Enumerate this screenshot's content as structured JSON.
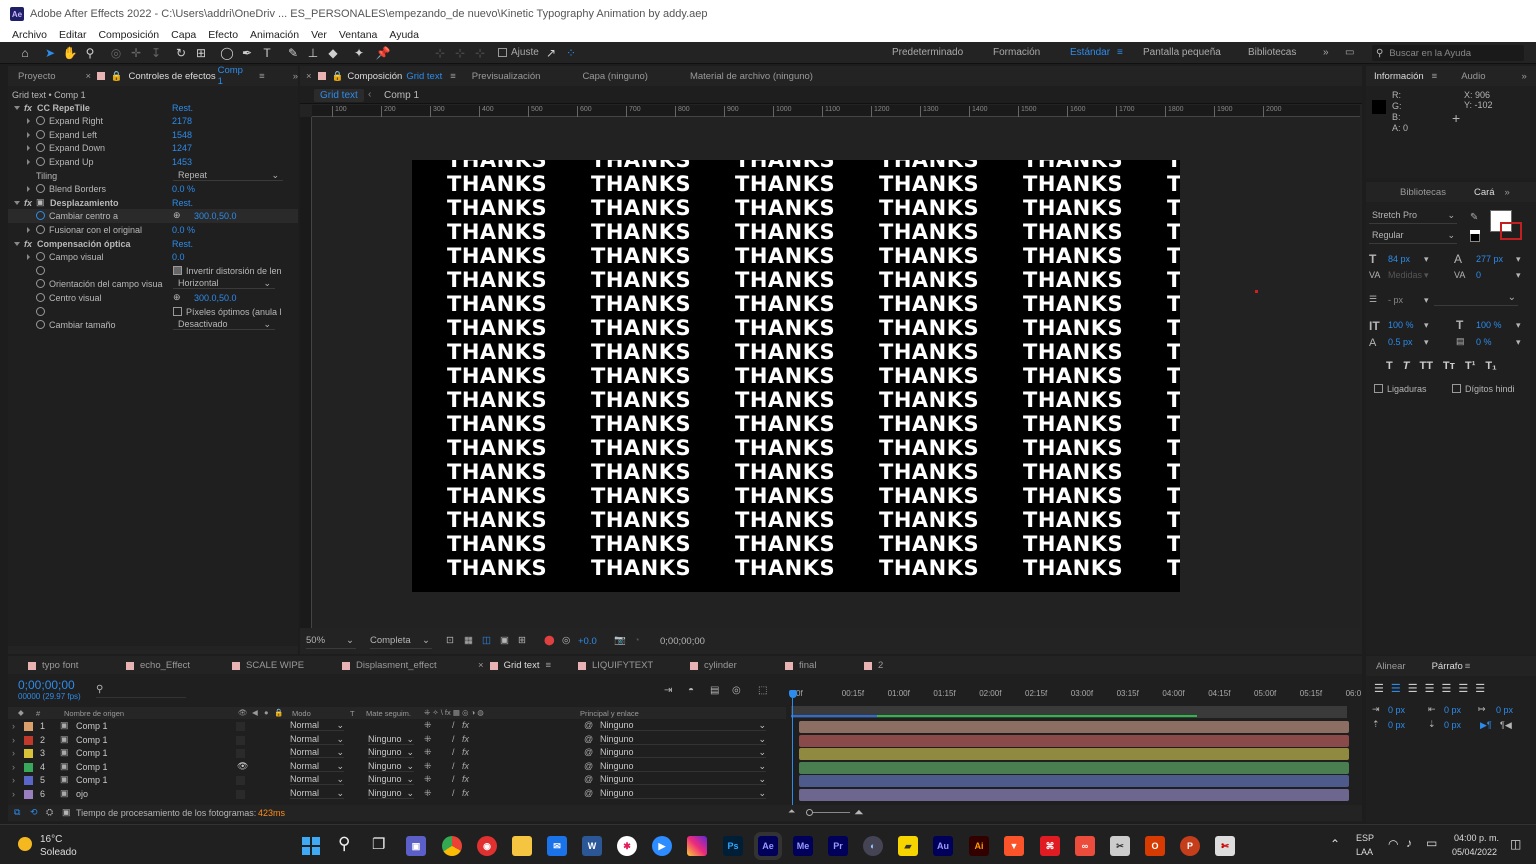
{
  "window": {
    "title": "Adobe After Effects 2022 - C:\\Users\\addri\\OneDriv ... ES_PERSONALES\\empezando_de nuevo\\Kinetic Typography Animation by addy.aep",
    "app_icon": "Ae"
  },
  "menu": [
    "Archivo",
    "Editar",
    "Composición",
    "Capa",
    "Efecto",
    "Animación",
    "Ver",
    "Ventana",
    "Ayuda"
  ],
  "toolbar": {
    "snap_label": "Ajuste",
    "workspaces": [
      "Predeterminado",
      "Formación",
      "Estándar",
      "Pantalla pequeña",
      "Bibliotecas"
    ],
    "active_workspace": "Estándar",
    "search_placeholder": "Buscar en la Ayuda"
  },
  "left_panel": {
    "tab_project": "Proyecto",
    "tab_effects": "Controles de efectos",
    "tab_effects_target": "Comp 1",
    "breadcrumb": "Grid text • Comp 1",
    "effects": [
      {
        "name": "CC RepeTile",
        "reset": "Rest."
      },
      {
        "name": "Desplazamiento",
        "reset": "Rest."
      },
      {
        "name": "Compensación óptica",
        "reset": "Rest."
      }
    ],
    "repetile": [
      {
        "label": "Expand Right",
        "value": "2178"
      },
      {
        "label": "Expand Left",
        "value": "1548"
      },
      {
        "label": "Expand Down",
        "value": "1247"
      },
      {
        "label": "Expand Up",
        "value": "1453"
      }
    ],
    "tiling_label": "Tiling",
    "tiling_value": "Repeat",
    "blend_label": "Blend Borders",
    "blend_value": "0.0 %",
    "offset_center_label": "Cambiar centro a",
    "offset_center_value": "300.0,50.0",
    "blend_orig_label": "Fusionar con el original",
    "blend_orig_value": "0.0 %",
    "fov_label": "Campo visual",
    "fov_value": "0.0",
    "invert_label": "Invertir distorsión de len",
    "fov_orient_label": "Orientación del campo visua",
    "fov_orient_value": "Horizontal",
    "view_center_label": "Centro visual",
    "view_center_value": "300.0,50.0",
    "optimal_label": "Píxeles óptimos (anula l",
    "resize_label": "Cambiar tamaño",
    "resize_value": "Desactivado"
  },
  "viewer": {
    "tab_comp": "Composición",
    "tab_comp_name": "Grid text",
    "tab_preview": "Previsualización",
    "tab_layer": "Capa (ninguno)",
    "tab_footage": "Material de archivo (ninguno)",
    "crumb_active": "Grid text",
    "crumb_next": "Comp 1",
    "ruler_ticks": [
      "100",
      "200",
      "300",
      "400",
      "500",
      "600",
      "700",
      "800",
      "900",
      "1000",
      "1100",
      "1200",
      "1300",
      "1400",
      "1500",
      "1600",
      "1700",
      "1800",
      "1900",
      "2000"
    ],
    "word": "THANKS",
    "row_count": 18,
    "zoom": "50%",
    "resolution": "Completa",
    "exposure": "+0.0",
    "timecode": "0;00;00;00"
  },
  "info_panel": {
    "tab_info": "Información",
    "tab_audio": "Audio",
    "r": "R:",
    "g": "G:",
    "b": "B:",
    "a": "A:  0",
    "x": "X:  906",
    "y": "Y:  -102"
  },
  "char_panel": {
    "tab_libraries": "Bibliotecas",
    "tab_char": "Cará",
    "font": "Stretch Pro",
    "style": "Regular",
    "size": "84 px",
    "leading": "277 px",
    "kerning": "Medidas",
    "tracking": "0",
    "stroke": "- px",
    "vscale": "100 %",
    "hscale": "100 %",
    "baseline": "0.5 px",
    "tsume": "0 %",
    "ligatures": "Ligaduras",
    "hindi": "Dígitos hindi",
    "style_buttons": [
      "T",
      "T",
      "TT",
      "Tт",
      "T¹",
      "T₁"
    ]
  },
  "para_panel": {
    "tab_align": "Alinear",
    "tab_para": "Párrafo",
    "indent_values": [
      "0 px",
      "0 px",
      "0 px",
      "0 px",
      "0 px"
    ]
  },
  "timeline": {
    "comp_tabs": [
      "typo font",
      "echo_Effect",
      "SCALE WIPE",
      "Displasment_effect",
      "Grid text",
      "LIQUIFYTEXT",
      "cylinder",
      "final",
      "2"
    ],
    "active_tab": "Grid text",
    "timecode": "0;00;00;00",
    "fps": "00000 (29.97 fps)",
    "col_source": "Nombre de origen",
    "col_mode": "Modo",
    "col_t": "T",
    "col_matte": "Mate seguim.",
    "col_parent": "Principal y enlace",
    "time_ticks": [
      "0f",
      "00:15f",
      "01:00f",
      "01:15f",
      "02:00f",
      "02:15f",
      "03:00f",
      "03:15f",
      "04:00f",
      "04:15f",
      "05:00f",
      "05:15f",
      "06:0"
    ],
    "layers": [
      {
        "num": "1",
        "name": "Comp 1",
        "mode": "Normal",
        "matte": "",
        "parent": "Ninguno",
        "color": "#d9a06b",
        "bar": "#8c6e62"
      },
      {
        "num": "2",
        "name": "Comp 1",
        "mode": "Normal",
        "matte": "Ninguno",
        "parent": "Ninguno",
        "color": "#c0392b",
        "bar": "#8a4a4a"
      },
      {
        "num": "3",
        "name": "Comp 1",
        "mode": "Normal",
        "matte": "Ninguno",
        "parent": "Ninguno",
        "color": "#d8c23a",
        "bar": "#8f8a40"
      },
      {
        "num": "4",
        "name": "Comp 1",
        "mode": "Normal",
        "matte": "Ninguno",
        "parent": "Ninguno",
        "color": "#3aa85a",
        "bar": "#4a7d50"
      },
      {
        "num": "5",
        "name": "Comp 1",
        "mode": "Normal",
        "matte": "Ninguno",
        "parent": "Ninguno",
        "color": "#5a66c8",
        "bar": "#4f5a8c"
      },
      {
        "num": "6",
        "name": "ojo",
        "mode": "Normal",
        "matte": "Ninguno",
        "parent": "Ninguno",
        "color": "#9a7fc0",
        "bar": "#6d6790"
      }
    ],
    "render_label": "Tiempo de procesamiento de los fotogramas:",
    "render_value": "423ms"
  },
  "taskbar": {
    "weather_temp": "16°C",
    "weather_desc": "Soleado",
    "lang1": "ESP",
    "lang2": "LAA",
    "time": "04:00 p. m.",
    "date": "05/04/2022",
    "apps": [
      {
        "name": "ps",
        "label": "Ps",
        "bg": "#001e36",
        "fg": "#31a8ff"
      },
      {
        "name": "ae",
        "label": "Ae",
        "bg": "#00005b",
        "fg": "#9999ff"
      },
      {
        "name": "me",
        "label": "Me",
        "bg": "#00005b",
        "fg": "#9999ff"
      },
      {
        "name": "pr",
        "label": "Pr",
        "bg": "#00005b",
        "fg": "#9999ff"
      },
      {
        "name": "au",
        "label": "Au",
        "bg": "#00005b",
        "fg": "#9999ff"
      },
      {
        "name": "ai",
        "label": "Ai",
        "bg": "#330000",
        "fg": "#ff9a00"
      }
    ]
  }
}
